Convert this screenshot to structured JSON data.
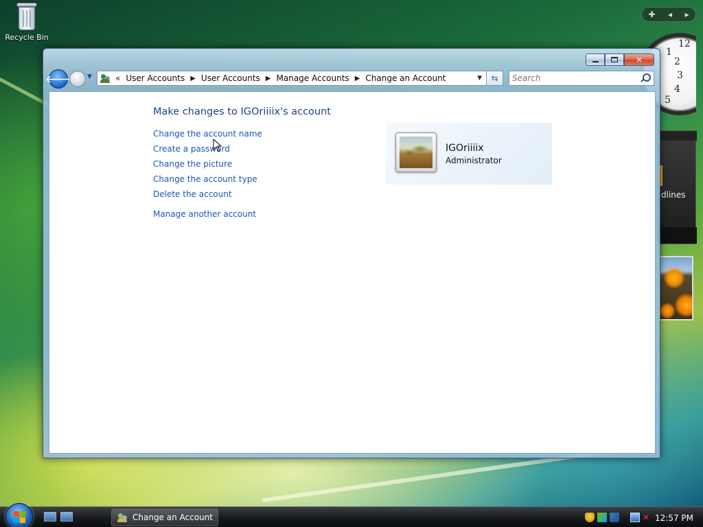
{
  "desktop": {
    "recycle_bin_label": "Recycle Bin",
    "gadget_headlines_text": "dlines",
    "clock_numbers": [
      "12",
      "1",
      "2",
      "3",
      "4",
      "5"
    ]
  },
  "window": {
    "title": "Change an Account",
    "breadcrumb": {
      "overflow": "«",
      "items": [
        "User Accounts",
        "User Accounts",
        "Manage Accounts",
        "Change an Account"
      ]
    },
    "search": {
      "placeholder": "Search"
    },
    "content": {
      "heading": "Make changes to IGOriiiix's account",
      "tasks": [
        "Change the account name",
        "Create a password",
        "Change the picture",
        "Change the account type",
        "Delete the account"
      ],
      "manage_other": "Manage another account",
      "account": {
        "name": "IGOriiiix",
        "type": "Administrator"
      }
    }
  },
  "taskbar": {
    "active_task": "Change an Account",
    "time": "12:57 PM"
  },
  "colors": {
    "link": "#1a55b8",
    "heading": "#1e3f8a",
    "taskbar": "#1a1c1f"
  }
}
